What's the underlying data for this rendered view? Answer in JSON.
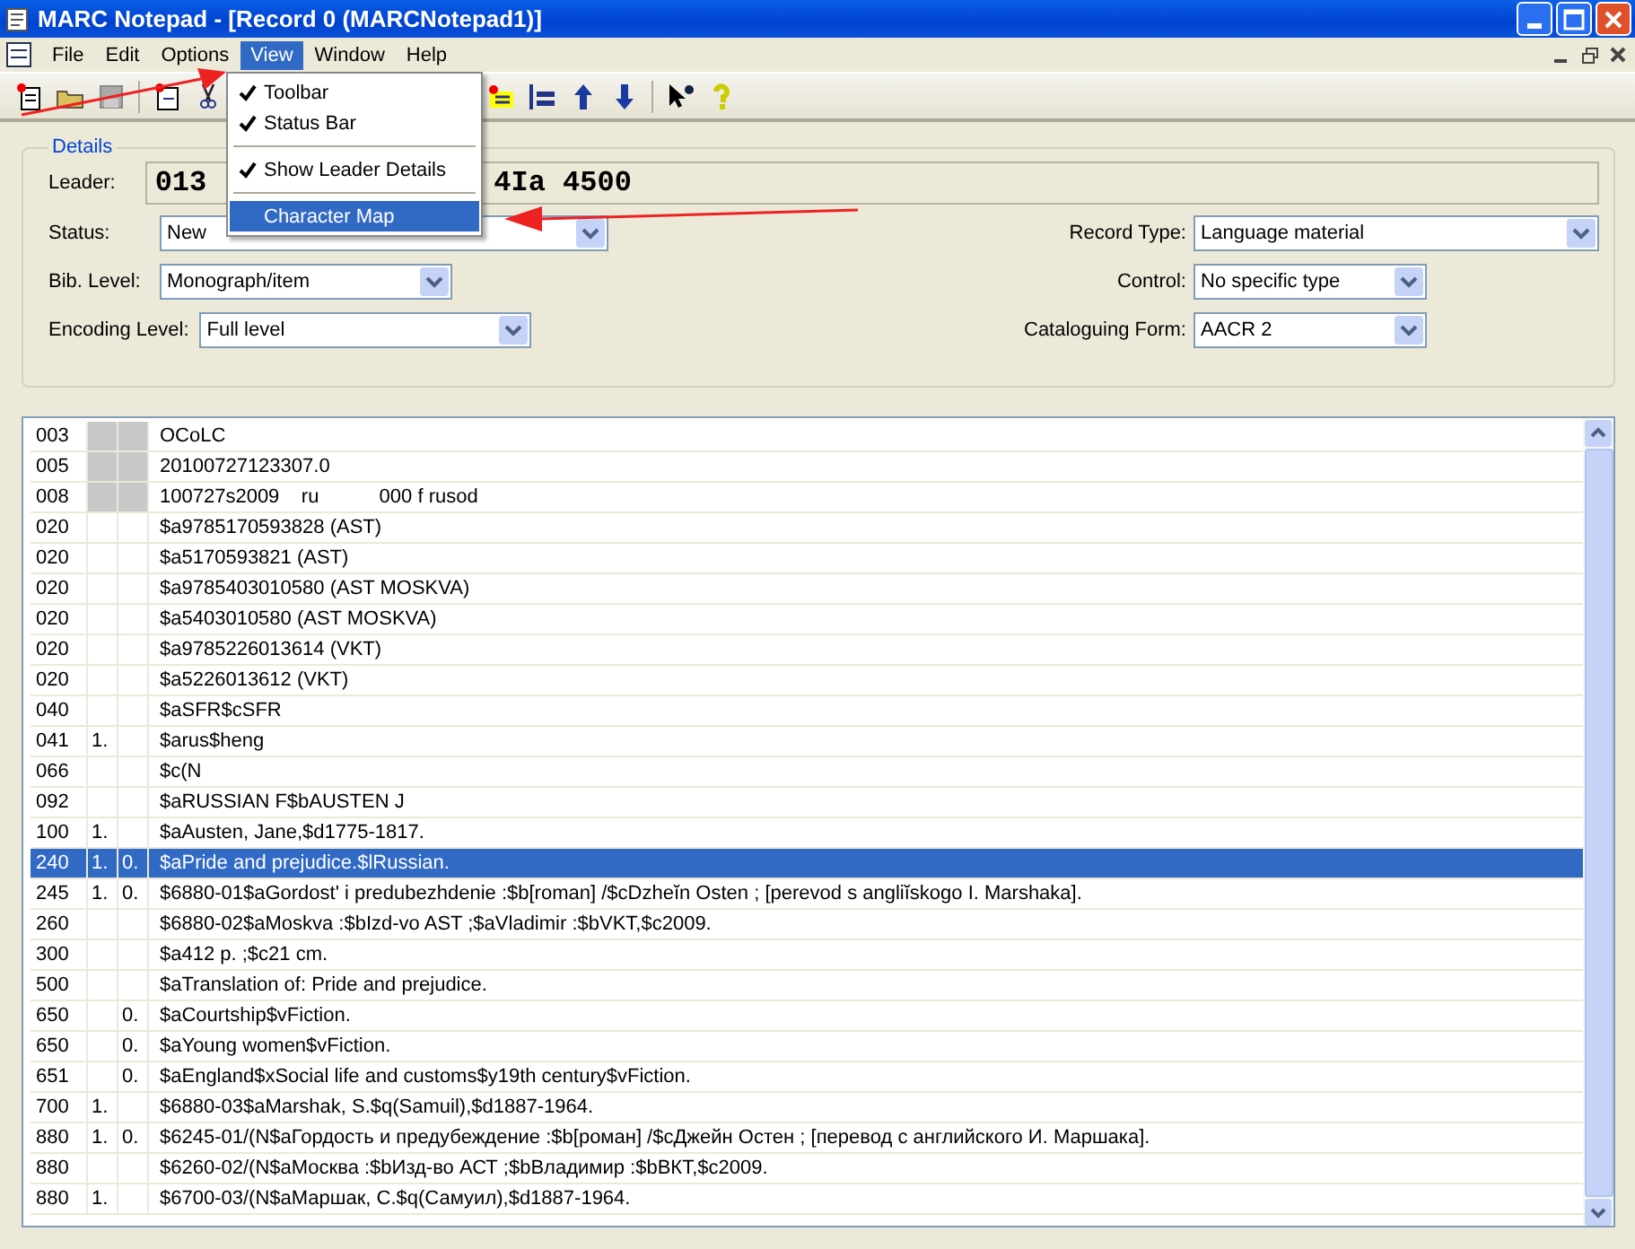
{
  "window": {
    "title": "MARC Notepad - [Record 0 (MARCNotepad1)]"
  },
  "menu": [
    {
      "label": "File",
      "selected": false
    },
    {
      "label": "Edit",
      "selected": false
    },
    {
      "label": "Options",
      "selected": false
    },
    {
      "label": "View",
      "selected": true
    },
    {
      "label": "Window",
      "selected": false
    },
    {
      "label": "Help",
      "selected": false
    }
  ],
  "view_menu": [
    {
      "kind": "item",
      "label": "Toolbar",
      "checked": true,
      "selected": false
    },
    {
      "kind": "item",
      "label": "Status Bar",
      "checked": true,
      "selected": false
    },
    {
      "kind": "separator"
    },
    {
      "kind": "item",
      "label": "Show Leader Details",
      "checked": true,
      "selected": false
    },
    {
      "kind": "separator"
    },
    {
      "kind": "item",
      "label": "Character Map",
      "checked": false,
      "selected": true
    }
  ],
  "details": {
    "title": "Details",
    "leader_label": "Leader:",
    "leader_parts": [
      "013",
      "4Ia 4500"
    ],
    "left": [
      {
        "label": "Status:",
        "value": "New"
      },
      {
        "label": "Bib. Level:",
        "value": "Monograph/item"
      },
      {
        "label": "Encoding Level:",
        "value": "Full level"
      }
    ],
    "right": [
      {
        "label": "Record Type:",
        "value": "Language material"
      },
      {
        "label": "Control:",
        "value": "No specific type"
      },
      {
        "label": "Cataloguing Form:",
        "value": "AACR 2"
      }
    ]
  },
  "rows": [
    {
      "kind": "control",
      "tag": "003",
      "ind1": "",
      "ind2": "",
      "data": "OCoLC",
      "selected": false
    },
    {
      "kind": "control",
      "tag": "005",
      "ind1": "",
      "ind2": "",
      "data": "20100727123307.0",
      "selected": false
    },
    {
      "kind": "control",
      "tag": "008",
      "ind1": "",
      "ind2": "",
      "data": "100727s2009    ru           000 f rusod",
      "selected": false
    },
    {
      "kind": "data",
      "tag": "020",
      "ind1": "",
      "ind2": "",
      "data": "$a9785170593828 (AST)",
      "selected": false
    },
    {
      "kind": "data",
      "tag": "020",
      "ind1": "",
      "ind2": "",
      "data": "$a5170593821 (AST)",
      "selected": false
    },
    {
      "kind": "data",
      "tag": "020",
      "ind1": "",
      "ind2": "",
      "data": "$a9785403010580 (AST MOSKVA)",
      "selected": false
    },
    {
      "kind": "data",
      "tag": "020",
      "ind1": "",
      "ind2": "",
      "data": "$a5403010580 (AST MOSKVA)",
      "selected": false
    },
    {
      "kind": "data",
      "tag": "020",
      "ind1": "",
      "ind2": "",
      "data": "$a9785226013614 (VKT)",
      "selected": false
    },
    {
      "kind": "data",
      "tag": "020",
      "ind1": "",
      "ind2": "",
      "data": "$a5226013612 (VKT)",
      "selected": false
    },
    {
      "kind": "data",
      "tag": "040",
      "ind1": "",
      "ind2": "",
      "data": "$aSFR$cSFR",
      "selected": false
    },
    {
      "kind": "data",
      "tag": "041",
      "ind1": "1.",
      "ind2": "",
      "data": "$arus$heng",
      "selected": false
    },
    {
      "kind": "data",
      "tag": "066",
      "ind1": "",
      "ind2": "",
      "data": "$c(N",
      "selected": false
    },
    {
      "kind": "data",
      "tag": "092",
      "ind1": "",
      "ind2": "",
      "data": "$aRUSSIAN F$bAUSTEN J",
      "selected": false
    },
    {
      "kind": "data",
      "tag": "100",
      "ind1": "1.",
      "ind2": "",
      "data": "$aAusten, Jane,$d1775-1817.",
      "selected": false
    },
    {
      "kind": "data",
      "tag": "240",
      "ind1": "1.",
      "ind2": "0.",
      "data": "$aPride and prejudice.$lRussian.",
      "selected": true
    },
    {
      "kind": "data",
      "tag": "245",
      "ind1": "1.",
      "ind2": "0.",
      "data": "$6880-01$aGordostʹ i predubezhdenie :$b[roman] /$cDzheĭn Osten ; [perevod s angliĭskogo I. Marshaka].",
      "selected": false
    },
    {
      "kind": "data",
      "tag": "260",
      "ind1": "",
      "ind2": "",
      "data": "$6880-02$aMoskva :$bIzd-vo AST ;$aVladimir :$bVKT,$c2009.",
      "selected": false
    },
    {
      "kind": "data",
      "tag": "300",
      "ind1": "",
      "ind2": "",
      "data": "$a412 p. ;$c21 cm.",
      "selected": false
    },
    {
      "kind": "data",
      "tag": "500",
      "ind1": "",
      "ind2": "",
      "data": "$aTranslation of: Pride and prejudice.",
      "selected": false
    },
    {
      "kind": "data",
      "tag": "650",
      "ind1": "",
      "ind2": "0.",
      "data": "$aCourtship$vFiction.",
      "selected": false
    },
    {
      "kind": "data",
      "tag": "650",
      "ind1": "",
      "ind2": "0.",
      "data": "$aYoung women$vFiction.",
      "selected": false
    },
    {
      "kind": "data",
      "tag": "651",
      "ind1": "",
      "ind2": "0.",
      "data": "$aEngland$xSocial life and customs$y19th century$vFiction.",
      "selected": false
    },
    {
      "kind": "data",
      "tag": "700",
      "ind1": "1.",
      "ind2": "",
      "data": "$6880-03$aMarshak, S.$q(Samuil),$d1887-1964.",
      "selected": false
    },
    {
      "kind": "data",
      "tag": "880",
      "ind1": "1.",
      "ind2": "0.",
      "data": "$6245-01/(N$aГордость и предубеждение :$b[роман] /$cДжейн Остен ; [перевод с английского И. Маршака].",
      "selected": false
    },
    {
      "kind": "data",
      "tag": "880",
      "ind1": "",
      "ind2": "",
      "data": "$6260-02/(N$aМосква :$bИзд-во АСТ ;$bВладимир :$bВКТ,$c2009.",
      "selected": false
    },
    {
      "kind": "data",
      "tag": "880",
      "ind1": "1.",
      "ind2": "",
      "data": "$6700-03/(N$aМаршак, С.$q(Самуил),$d1887-1964.",
      "selected": false
    }
  ]
}
